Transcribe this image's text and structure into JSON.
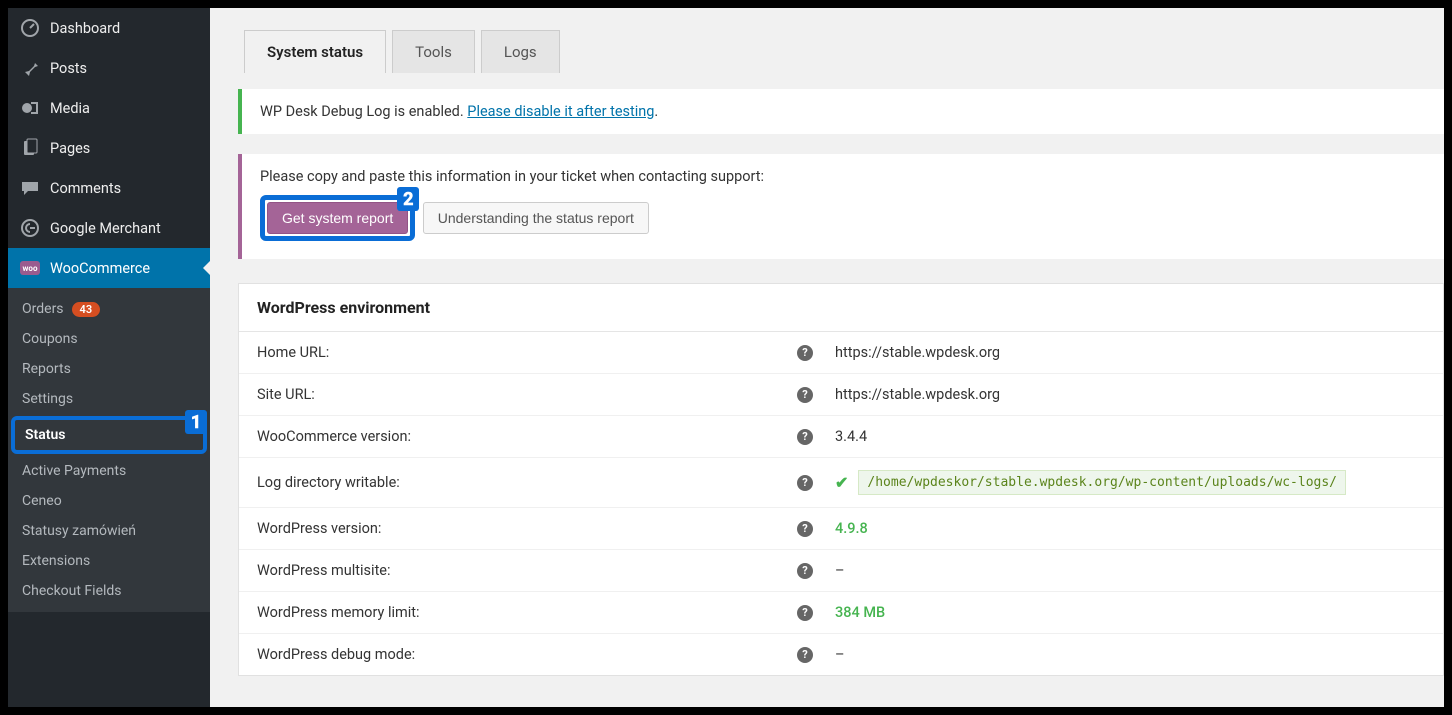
{
  "sidebar": {
    "dashboard": "Dashboard",
    "posts": "Posts",
    "media": "Media",
    "pages": "Pages",
    "comments": "Comments",
    "google_merchant": "Google Merchant",
    "woocommerce": "WooCommerce",
    "submenu": {
      "orders": "Orders",
      "orders_badge": "43",
      "coupons": "Coupons",
      "reports": "Reports",
      "settings": "Settings",
      "status": "Status",
      "active_payments": "Active Payments",
      "ceneo": "Ceneo",
      "statusy": "Statusy zamówień",
      "extensions": "Extensions",
      "checkout_fields": "Checkout Fields"
    }
  },
  "tabs": {
    "system_status": "System status",
    "tools": "Tools",
    "logs": "Logs"
  },
  "notice": {
    "prefix": "WP Desk Debug Log is enabled. ",
    "link": "Please disable it after testing",
    "suffix": "."
  },
  "panel": {
    "instruction": "Please copy and paste this information in your ticket when contacting support:",
    "get_report": "Get system report",
    "understand": "Understanding the status report"
  },
  "annotations": {
    "one": "1",
    "two": "2"
  },
  "env": {
    "header": "WordPress environment",
    "rows": {
      "home_url": {
        "label": "Home URL:",
        "value": "https://stable.wpdesk.org"
      },
      "site_url": {
        "label": "Site URL:",
        "value": "https://stable.wpdesk.org"
      },
      "wc_version": {
        "label": "WooCommerce version:",
        "value": "3.4.4"
      },
      "log_writable": {
        "label": "Log directory writable:",
        "value": "/home/wpdeskor/stable.wpdesk.org/wp-content/uploads/wc-logs/"
      },
      "wp_version": {
        "label": "WordPress version:",
        "value": "4.9.8"
      },
      "multisite": {
        "label": "WordPress multisite:",
        "value": "–"
      },
      "memory": {
        "label": "WordPress memory limit:",
        "value": "384 MB"
      },
      "debug": {
        "label": "WordPress debug mode:",
        "value": "–"
      }
    }
  }
}
